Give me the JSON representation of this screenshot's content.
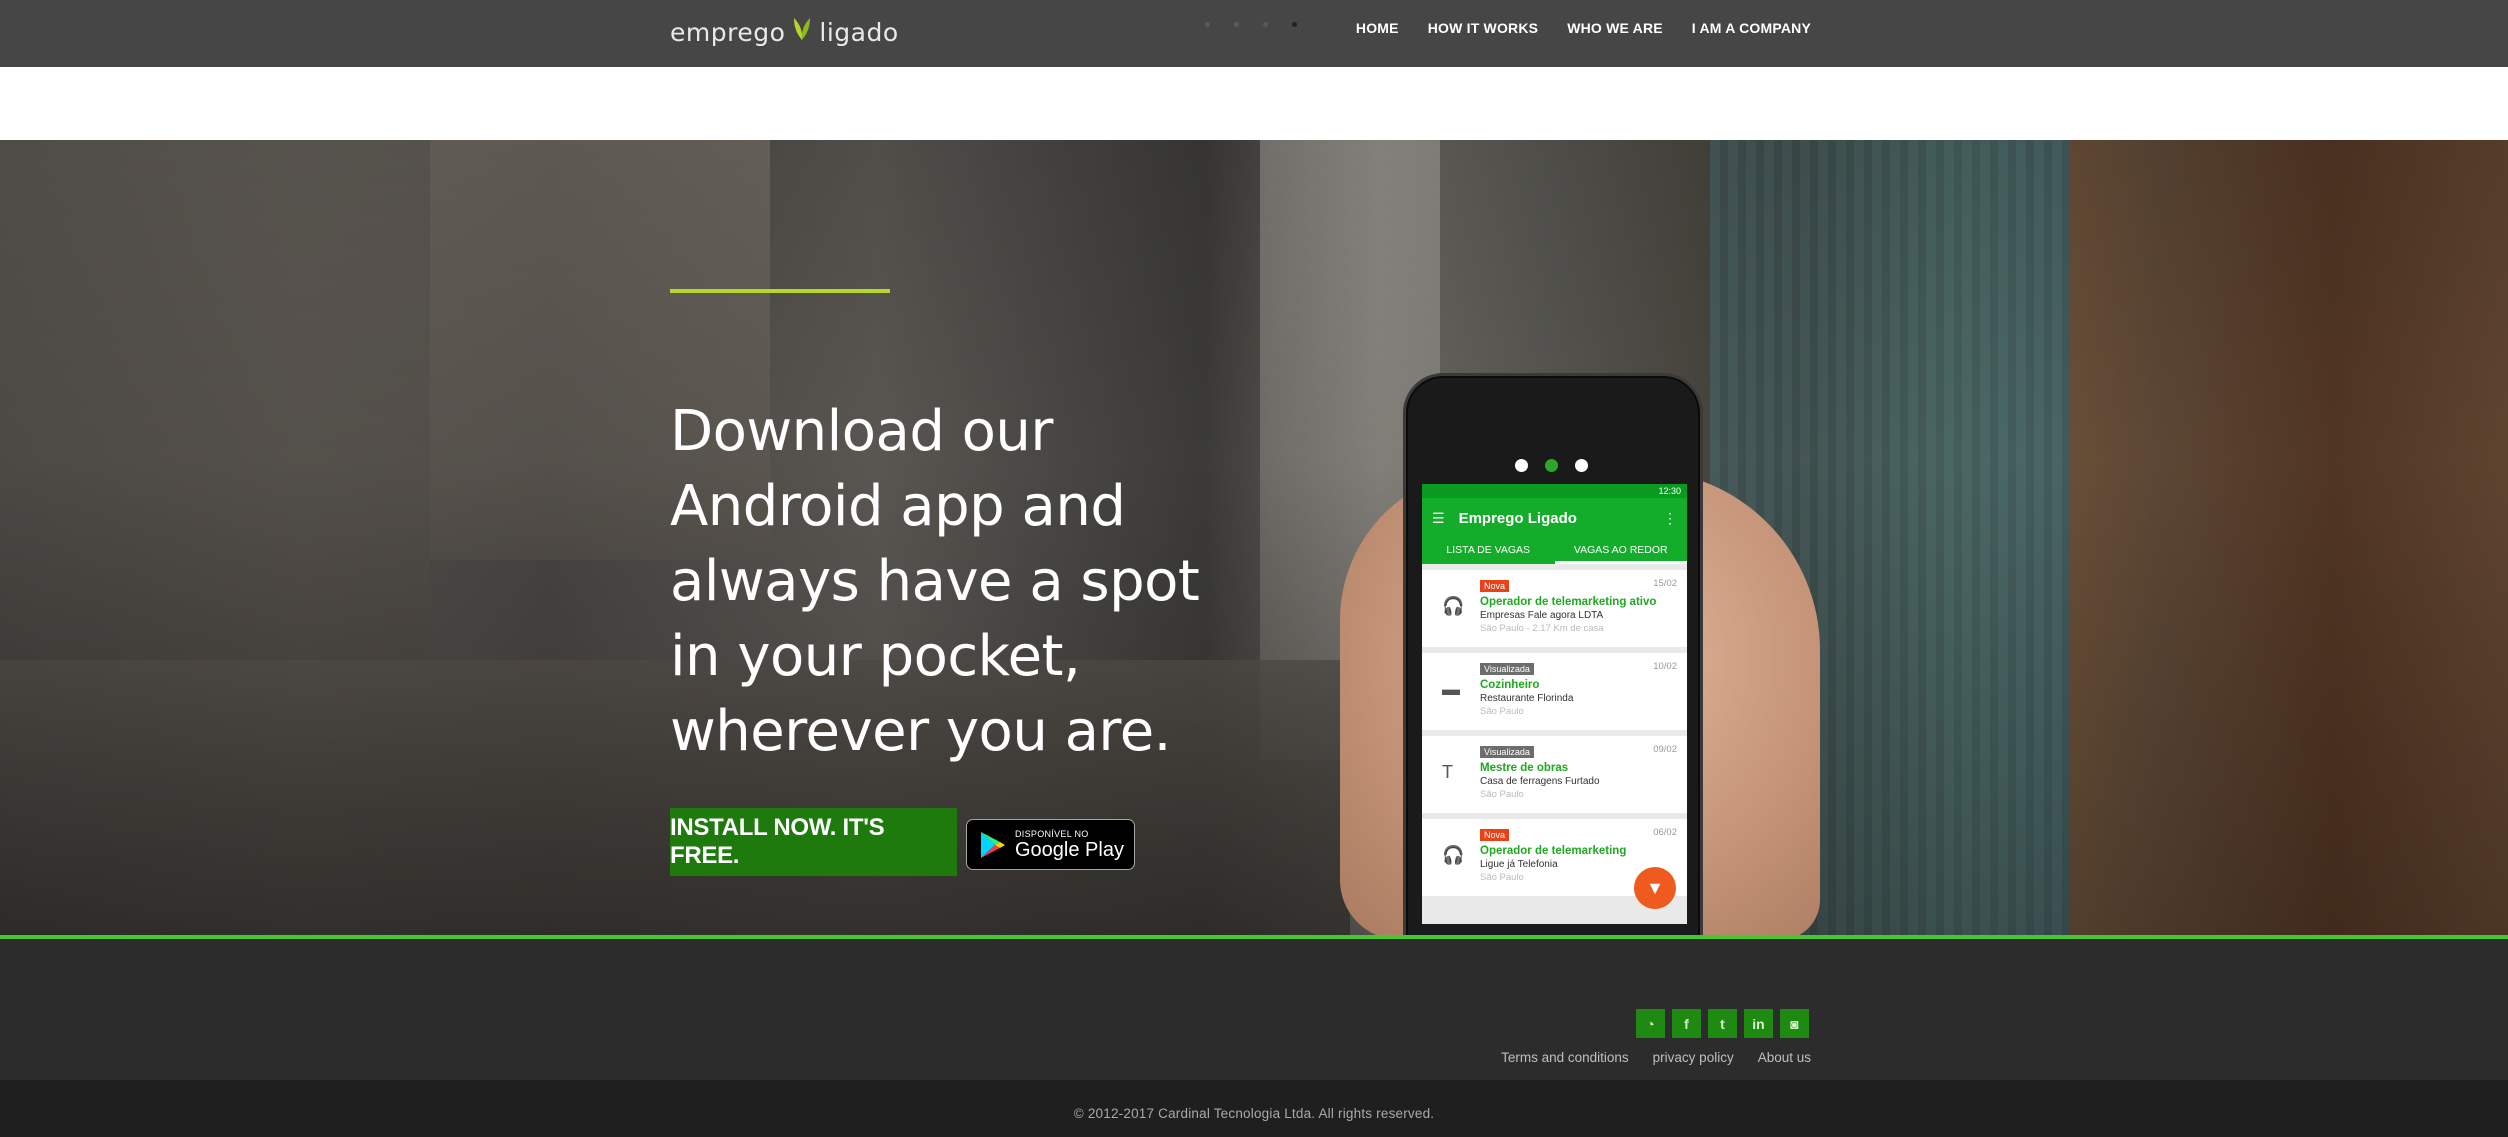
{
  "header": {
    "logo_left": "emprego",
    "logo_right": "ligado",
    "slider_dots": 4,
    "nav": [
      "HOME",
      "HOW IT WORKS",
      "WHO WE ARE",
      "I AM A COMPANY"
    ]
  },
  "hero": {
    "headline": "Download our Android app and always have a spot in your pocket, wherever you are.",
    "install_button": "INSTALL NOW. IT'S FREE.",
    "google_play_small": "DISPONÍVEL NO",
    "google_play_big": "Google Play",
    "accent_color": "#b6d72a"
  },
  "phone": {
    "status_time": "12:30",
    "app_title": "Emprego Ligado",
    "tabs": [
      "LISTA DE VAGAS",
      "VAGAS AO REDOR"
    ],
    "jobs": [
      {
        "badge": "Nova",
        "date": "15/02",
        "title": "Operador de telemarketing ativo",
        "company": "Empresas Fale agora LDTA",
        "location": "São Paulo - 2.17 Km de casa"
      },
      {
        "badge": "Visualizada",
        "date": "10/02",
        "title": "Cozinheiro",
        "company": "Restaurante Florinda",
        "location": "São Paulo"
      },
      {
        "badge": "Visualizada",
        "date": "09/02",
        "title": "Mestre de obras",
        "company": "Casa de ferragens Furtado",
        "location": "São Paulo"
      },
      {
        "badge": "Nova",
        "date": "06/02",
        "title": "Operador de telemarketing",
        "company": "Ligue já Telefonia",
        "location": "São Paulo"
      }
    ],
    "brand_color": "#14ad2b"
  },
  "footer": {
    "social": [
      "rss-icon",
      "facebook-icon",
      "twitter-icon",
      "linkedin-icon",
      "instagram-icon"
    ],
    "links": [
      "Terms and conditions",
      "privacy policy",
      "About us"
    ],
    "copyright": "© 2012-2017 Cardinal Tecnologia Ltda. All rights reserved."
  }
}
